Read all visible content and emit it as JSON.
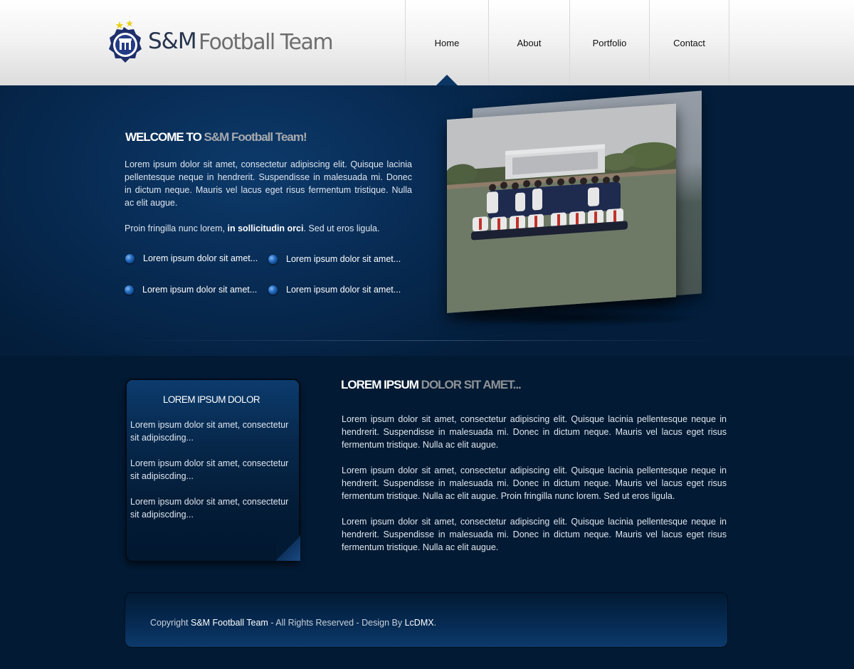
{
  "header": {
    "logo_text_brand": "S&M",
    "logo_text_name": "Football Team",
    "nav": [
      {
        "label": "Home",
        "active": true
      },
      {
        "label": "About",
        "active": false
      },
      {
        "label": "Portfolio",
        "active": false
      },
      {
        "label": "Contact",
        "active": false
      }
    ]
  },
  "hero": {
    "title_main": "WELCOME TO ",
    "title_highlight": "S&M Football Team!",
    "paragraph": "Lorem ipsum dolor sit amet, consectetur adipiscing elit. Quisque lacinia pellentesque neque in hendrerit. Suspendisse in malesuada mi. Donec in dictum neque. Mauris vel lacus eget risus fermentum tristique. Nulla ac elit augue.",
    "paragraph2_start": "Proin fringilla nunc lorem, ",
    "paragraph2_bold": "in sollicitudin orci",
    "paragraph2_end": ". Sed ut eros ligula.",
    "links": [
      "Lorem ipsum dolor sit amet...",
      "Lorem ipsum dolor sit amet...",
      "Lorem ipsum dolor sit amet...",
      "Lorem ipsum dolor sit amet..."
    ]
  },
  "sidebar": {
    "title": "LOREM IPSUM DOLOR",
    "items": [
      "Lorem ipsum dolor sit amet, consectetur sit adipiscding...",
      "Lorem ipsum dolor sit amet, consectetur sit adipiscding...",
      "Lorem ipsum dolor sit amet, consectetur sit adipiscding..."
    ]
  },
  "main": {
    "title_main": "LOREM IPSUM ",
    "title_highlight": "DOLOR SIT AMET...",
    "paragraphs": [
      "Lorem ipsum dolor sit amet, consectetur adipiscing elit. Quisque lacinia pellentesque neque in hendrerit. Suspendisse in malesuada mi. Donec in dictum neque. Mauris vel lacus eget risus fermentum tristique. Nulla ac elit augue.",
      "Lorem ipsum dolor sit amet, consectetur adipiscing elit. Quisque lacinia pellentesque neque in hendrerit. Suspendisse in malesuada mi. Donec in dictum neque. Mauris vel lacus eget risus fermentum tristique. Nulla ac elit augue. Proin fringilla nunc lorem. Sed ut eros ligula.",
      "Lorem ipsum dolor sit amet, consectetur adipiscing elit. Quisque lacinia pellentesque neque in hendrerit. Suspendisse in malesuada mi. Donec in dictum neque. Mauris vel lacus eget risus fermentum tristique. Nulla ac elit augue."
    ]
  },
  "footer": {
    "prefix": "Copyright ",
    "brand": "S&M Football Team",
    "middle": " - All Rights Reserved - Design By ",
    "designer": "LcDMX",
    "suffix": "."
  },
  "colors": {
    "background": "#021a33",
    "accent": "#0a3564",
    "highlight_text": "#a7a9ad"
  },
  "icons": [
    "team-crest-icon",
    "bullet-dot-icon"
  ]
}
